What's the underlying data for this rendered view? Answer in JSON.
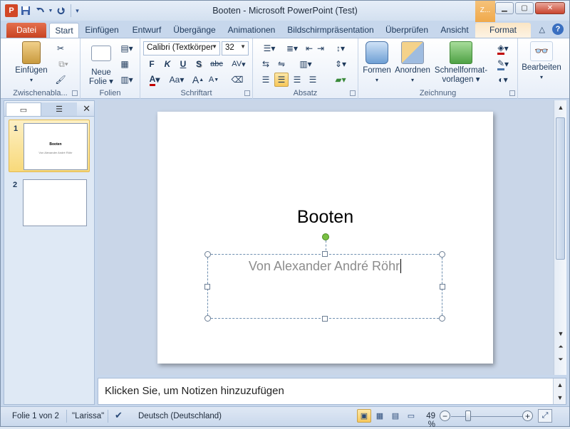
{
  "app": {
    "title": "Booten  -  Microsoft PowerPoint (Test)",
    "context_tab_short": "Z...",
    "logo_letter": "P"
  },
  "qat": {
    "save_icon": "save-icon",
    "undo_icon": "undo-icon",
    "redo_icon": "redo-icon",
    "customize_icon": "chevron-down-icon"
  },
  "tabs": {
    "file": "Datei",
    "items": [
      "Start",
      "Einfügen",
      "Entwurf",
      "Übergänge",
      "Animationen",
      "Bildschirmpräsentation",
      "Überprüfen",
      "Ansicht"
    ],
    "format": "Format"
  },
  "ribbon": {
    "clipboard": {
      "label": "Zwischenabla...",
      "paste": "Einfügen"
    },
    "slides": {
      "label": "Folien",
      "new_slide_1": "Neue",
      "new_slide_2": "Folie"
    },
    "font": {
      "label": "Schriftart",
      "font_name": "Calibri (Textkörper",
      "font_size": "32",
      "bold": "F",
      "italic": "K",
      "underline": "U",
      "shadow": "S",
      "strike": "abc",
      "spacing": "AV",
      "color": "A",
      "case": "Aa",
      "grow": "A",
      "shrink": "A"
    },
    "paragraph": {
      "label": "Absatz"
    },
    "drawing": {
      "label": "Zeichnung",
      "shapes": "Formen",
      "arrange": "Anordnen",
      "quick_styles_1": "Schnellformat-",
      "quick_styles_2": "vorlagen"
    },
    "editing": {
      "label": "Bearbeiten"
    }
  },
  "slides_pane": {
    "close": "✕",
    "thumbs": [
      {
        "num": "1",
        "title": "Booten",
        "subtitle": "Von Alexander André Röhr"
      },
      {
        "num": "2",
        "title": "",
        "subtitle": ""
      }
    ]
  },
  "slide": {
    "title": "Booten",
    "subtitle": "Von Alexander André Röhr"
  },
  "notes": {
    "placeholder": "Klicken Sie, um Notizen hinzuzufügen"
  },
  "status": {
    "slide_info": "Folie 1 von 2",
    "theme": "\"Larissa\"",
    "language": "Deutsch (Deutschland)",
    "zoom": "49 %"
  },
  "colors": {
    "file_tab": "#c84322",
    "accent": "#1e395b",
    "rotate_handle": "#79c043",
    "selection": "#f8c85a"
  }
}
